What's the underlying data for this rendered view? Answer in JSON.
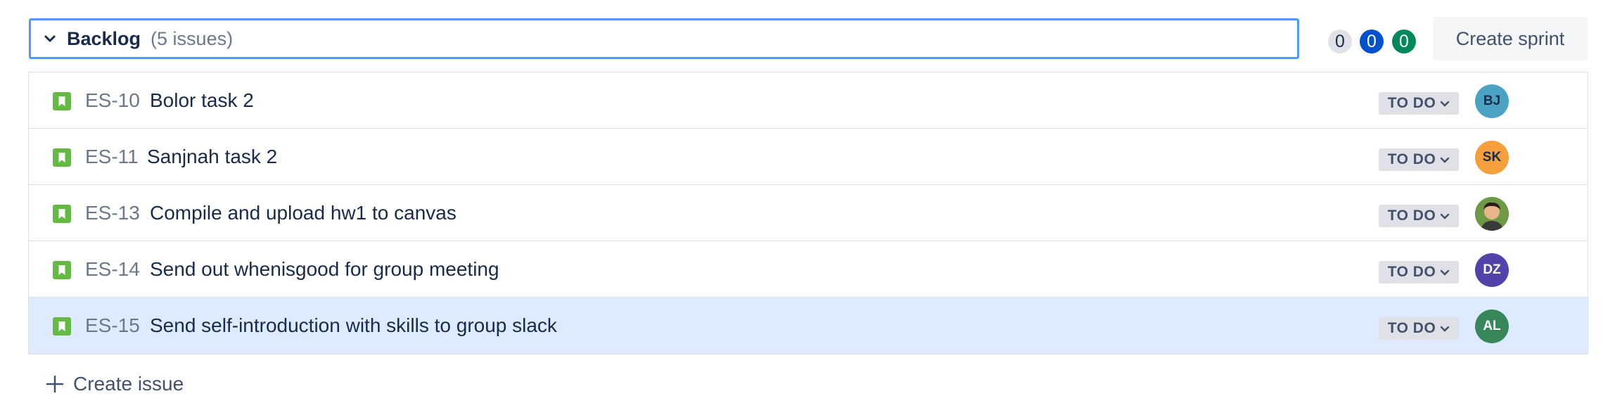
{
  "backlog": {
    "title": "Backlog",
    "count": "(5 issues)",
    "counters": {
      "todo": "0",
      "in_progress": "0",
      "done": "0"
    },
    "create_sprint_label": "Create sprint"
  },
  "issues": [
    {
      "key": "ES-10",
      "summary": "Bolor task 2",
      "status": "TO DO",
      "assignee": "BJ",
      "avatar_color": "#4ba3c3",
      "avatar_text_color": "#172b4d"
    },
    {
      "key": "ES-11",
      "summary": "Sanjnah task 2",
      "status": "TO DO",
      "assignee": "SK",
      "avatar_color": "#f79f3c",
      "avatar_text_color": "#172b4d"
    },
    {
      "key": "ES-13",
      "summary": "Compile and upload hw1 to canvas",
      "status": "TO DO",
      "assignee": "",
      "avatar_color": "#7a9a4e",
      "avatar_text_color": "#ffffff"
    },
    {
      "key": "ES-14",
      "summary": "Send out whenisgood for group meeting",
      "status": "TO DO",
      "assignee": "DZ",
      "avatar_color": "#5243aa",
      "avatar_text_color": "#ffffff"
    },
    {
      "key": "ES-15",
      "summary": "Send self-introduction with skills to group slack",
      "status": "TO DO",
      "assignee": "AL",
      "avatar_color": "#36875a",
      "avatar_text_color": "#ffffff"
    }
  ],
  "footer": {
    "create_issue_label": "Create issue"
  },
  "colors": {
    "story": "#65ba43",
    "focus": "#4c9aff",
    "selected_row": "#deebff"
  }
}
